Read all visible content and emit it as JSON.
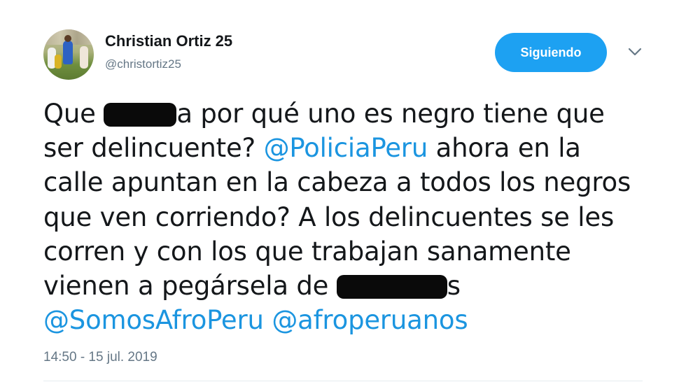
{
  "user": {
    "name": "Christian Ortiz 25",
    "handle": "@christortiz25"
  },
  "follow_button": {
    "label": "Siguiendo"
  },
  "tweet": {
    "line1_a": "Que ",
    "line1_b": "a por qué uno es negro tiene que",
    "line2_a": "ser delincuente? ",
    "mention_policia": "@PoliciaPeru",
    "line2_b": " ahora en la",
    "line3": "calle apuntan en la cabeza a todos los negros",
    "line4": "que ven corriendo? A los delincuentes se les",
    "line5": "corren y con los que trabajan sanamente",
    "line6_a": "vienen a pegársela de ",
    "line6_b": "s",
    "mention_somos": "@SomosAfroPeru",
    "mention_afro": "@afroperuanos"
  },
  "timestamp": "14:50 - 15 jul. 2019",
  "colors": {
    "accent": "#1da1f2",
    "mention": "#1b95e0",
    "secondary_text": "#657786"
  },
  "icons": {
    "more": "chevron-down-icon"
  }
}
